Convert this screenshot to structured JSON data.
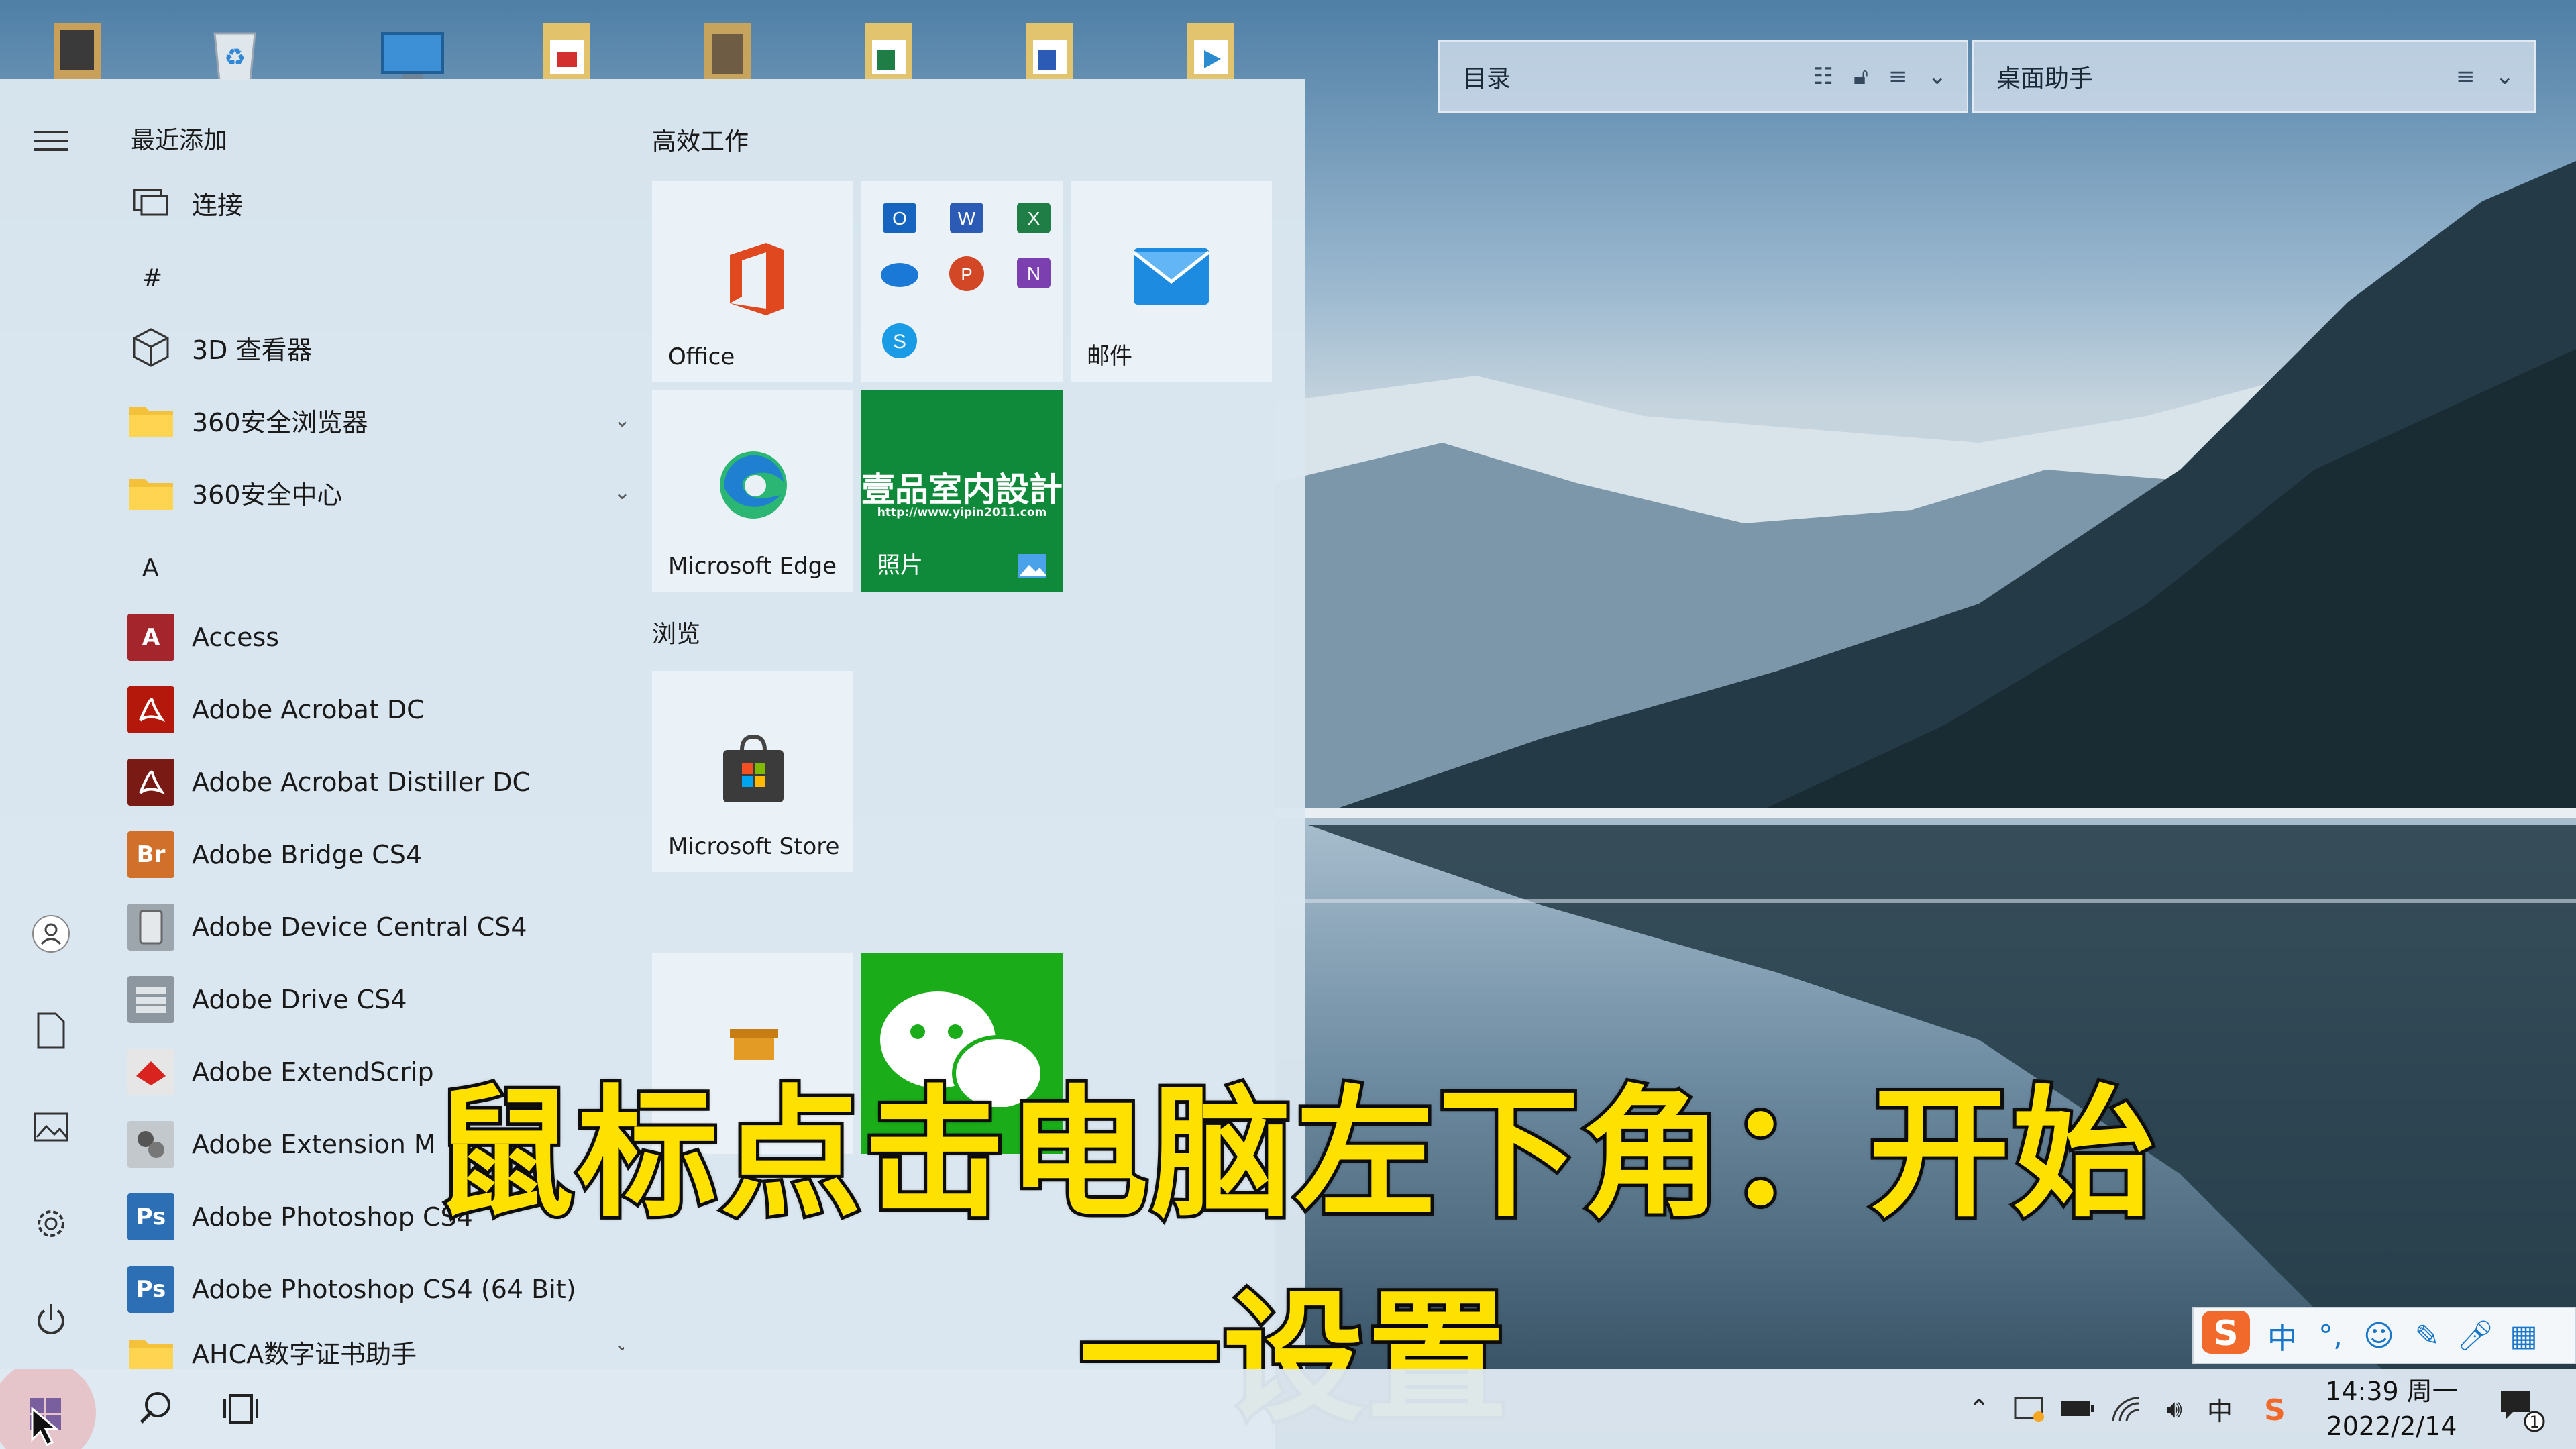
{
  "desktop": {
    "icons": [
      "computer-icon",
      "recycle-bin-icon",
      "monitor-icon",
      "pdf-file-icon",
      "archive-icon",
      "excel-file-icon",
      "word-file-icon",
      "video-file-icon"
    ],
    "widgets": [
      {
        "title": "目录"
      },
      {
        "title": "桌面助手"
      }
    ]
  },
  "start_menu": {
    "recent_header": "最近添加",
    "recent_items": [
      {
        "label": "连接"
      }
    ],
    "groups": [
      {
        "letter": "#",
        "items": [
          {
            "label": "3D 查看器"
          },
          {
            "label": "360安全浏览器",
            "expandable": true
          },
          {
            "label": "360安全中心",
            "expandable": true
          }
        ]
      },
      {
        "letter": "A",
        "items": [
          {
            "label": "Access"
          },
          {
            "label": "Adobe Acrobat DC"
          },
          {
            "label": "Adobe Acrobat Distiller DC"
          },
          {
            "label": "Adobe Bridge CS4"
          },
          {
            "label": "Adobe Device Central CS4"
          },
          {
            "label": "Adobe Drive CS4"
          },
          {
            "label": "Adobe ExtendScrip"
          },
          {
            "label": "Adobe Extension M"
          },
          {
            "label": "Adobe Photoshop CS4"
          },
          {
            "label": "Adobe Photoshop CS4 (64 Bit)"
          },
          {
            "label": "AHCA数字证书助手",
            "expandable": true
          }
        ]
      }
    ],
    "icon_badges": {
      "access": "A",
      "bridge": "Br",
      "photoshop": "Ps"
    },
    "tile_sections": [
      {
        "title": "高效工作",
        "tiles": [
          {
            "label": "Office"
          },
          {
            "label": ""
          },
          {
            "label": "邮件"
          },
          {
            "label": "Microsoft Edge"
          },
          {
            "label": "照片",
            "photo_text": "壹品室内設計",
            "photo_url": "http://www.yipin2011.com"
          }
        ]
      },
      {
        "title": "浏览",
        "tiles": [
          {
            "label": "Microsoft Store"
          }
        ]
      }
    ]
  },
  "subtitle": "鼠标点击电脑左下角：开始一设置",
  "ime": {
    "segments": [
      "中",
      "°,"
    ]
  },
  "taskbar": {
    "tray_lang": "中",
    "time": "14:39 周一",
    "date": "2022/2/14",
    "notification_count": "1"
  },
  "colors": {
    "accent": "#1877c9",
    "subtitle": "#ffe100",
    "wechat": "#1aad19",
    "photo_tile": "#0f8a3a"
  }
}
